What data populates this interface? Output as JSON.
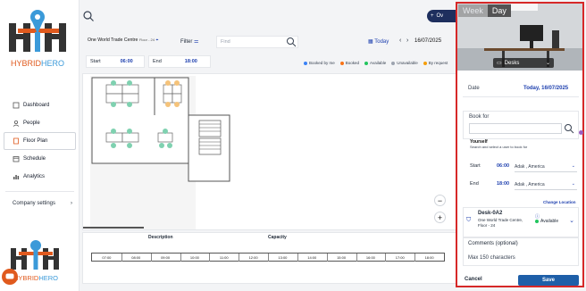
{
  "app": {
    "brand": "HYBRIDHERO"
  },
  "sidebar": {
    "items": [
      {
        "label": "Dashboard",
        "icon": "dashboard-icon"
      },
      {
        "label": "People",
        "icon": "people-icon"
      },
      {
        "label": "Floor Plan",
        "icon": "floorplan-icon",
        "active": true
      },
      {
        "label": "Schedule",
        "icon": "calendar-icon"
      },
      {
        "label": "Analytics",
        "icon": "analytics-icon"
      }
    ],
    "company_settings": "Company settings"
  },
  "header": {
    "action_label": "Ov"
  },
  "filter": {
    "location": "One World Trade Centre",
    "floor": "Floor - 24",
    "filter_label": "Filter",
    "find_placeholder": "Find",
    "today_label": "Today",
    "date": "16/07/2025"
  },
  "time": {
    "start_label": "Start",
    "start_value": "06:00",
    "end_label": "End",
    "end_value": "18:00"
  },
  "legend": [
    {
      "label": "Booked by me",
      "color": "#3b82f6"
    },
    {
      "label": "Booked",
      "color": "#f97316"
    },
    {
      "label": "Available",
      "color": "#22c55e"
    },
    {
      "label": "Unavailable",
      "color": "#9ca3af"
    },
    {
      "label": "By request",
      "color": "#f59e0b"
    }
  ],
  "timeline": {
    "description_label": "Description",
    "capacity_label": "Capacity",
    "hours": [
      "07:00",
      "08:00",
      "09:00",
      "10:00",
      "11:00",
      "12:00",
      "13:00",
      "14:00",
      "15:00",
      "16:00",
      "17:00",
      "18:00"
    ]
  },
  "panel": {
    "toggle": {
      "week": "Week",
      "day": "Day"
    },
    "resource_type": "Desks",
    "date_label": "Date",
    "date_value": "Today, 16/07/2025",
    "book_for_label": "Book for",
    "yourself_label": "Yourself",
    "search_hint": "Search and select a user to book for",
    "start_label": "Start",
    "start_value": "06:00",
    "start_tz": "Adak , America",
    "end_label": "End",
    "end_value": "18:00",
    "end_tz": "Adak , America",
    "change_location": "Change Location",
    "desk_name": "Desk-0A2",
    "desk_location": "One World Trade Centre,",
    "desk_floor": "Floor - 24",
    "desk_status": "Available",
    "comments_label": "Comments (optional)",
    "comments_placeholder": "Max 150 characters",
    "cancel_label": "Cancel",
    "save_label": "Save"
  },
  "colors": {
    "accent": "#1e40af",
    "brand_orange": "#e05a1e",
    "highlight_border": "#d62828"
  }
}
